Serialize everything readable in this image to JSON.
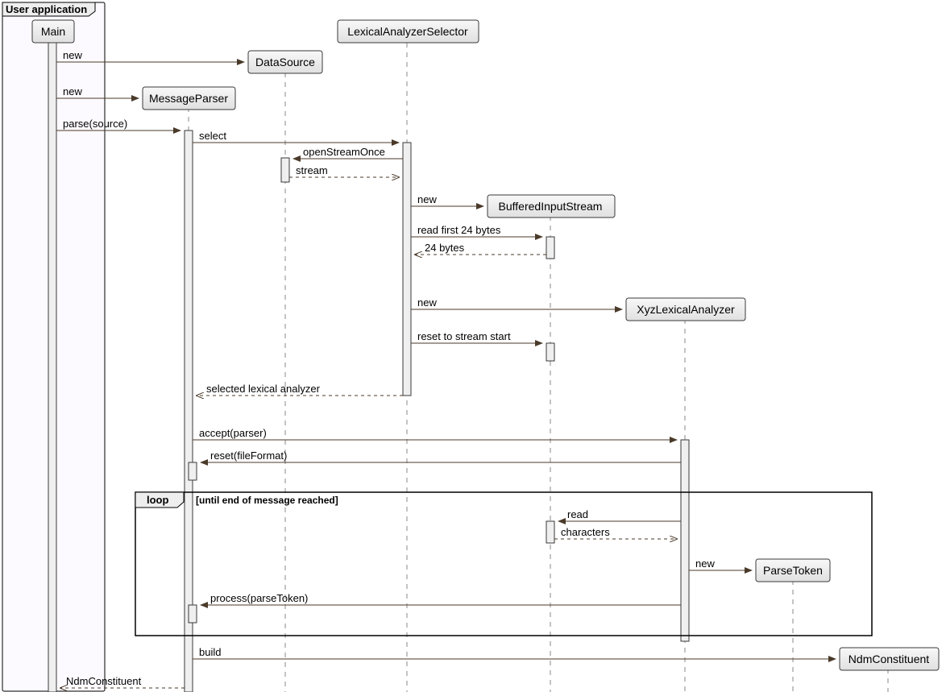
{
  "group": {
    "title": "User application"
  },
  "participants": {
    "main": "Main",
    "dataSource": "DataSource",
    "messageParser": "MessageParser",
    "selector": "LexicalAnalyzerSelector",
    "buffered": "BufferedInputStream",
    "xyz": "XyzLexicalAnalyzer",
    "parseToken": "ParseToken",
    "ndm": "NdmConstituent"
  },
  "messages": {
    "new1": "new",
    "new2": "new",
    "parse": "parse(source)",
    "select": "select",
    "openStream": "openStreamOnce",
    "stream": "stream",
    "new3": "new",
    "readFirst": "read first 24 bytes",
    "bytes24": "24 bytes",
    "new4": "new",
    "resetStream": "reset to stream start",
    "selectedAnalyzer": "selected lexical analyzer",
    "accept": "accept(parser)",
    "resetFmt": "reset(fileFormat)",
    "read": "read",
    "characters": "characters",
    "new5": "new",
    "process": "process(parseToken)",
    "build": "build",
    "ndmReturn": "NdmConstituent"
  },
  "loop": {
    "title": "loop",
    "condition": "[until end of message reached]"
  }
}
